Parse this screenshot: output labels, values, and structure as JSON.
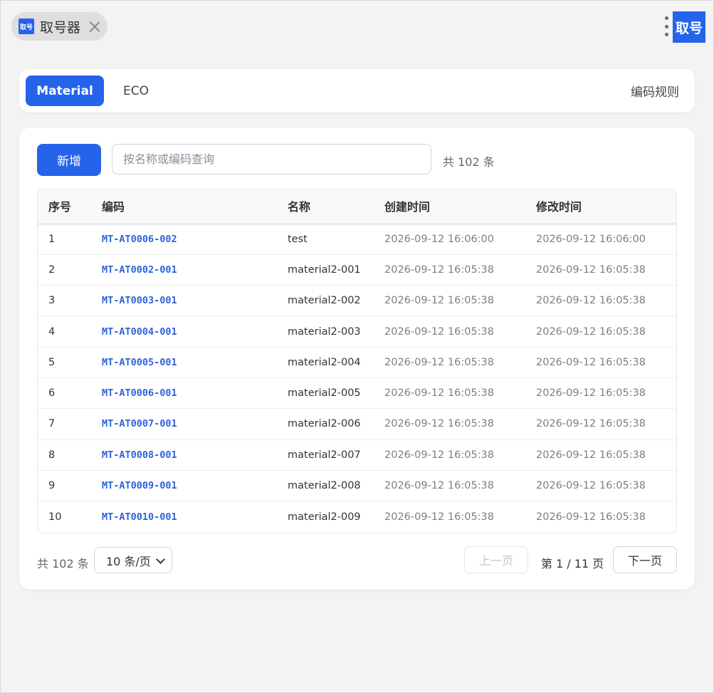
{
  "app_tab": {
    "icon_text": "取号",
    "title": "取号器"
  },
  "brand_badge": "取号",
  "tabs": [
    {
      "label": "Material",
      "active": true
    },
    {
      "label": "ECO",
      "active": false
    }
  ],
  "rules_tab": "编码规则",
  "toolbar": {
    "add_label": "新增",
    "search_placeholder": "按名称或编码查询",
    "search_value": "",
    "total_text": "共 102 条"
  },
  "table": {
    "columns": [
      "序号",
      "编码",
      "名称",
      "创建时间",
      "修改时间"
    ],
    "rows": [
      {
        "index": "1",
        "code": "MT-AT0006-002",
        "name": "test",
        "created": "2026-09-12 16:06:00",
        "modified": "2026-09-12 16:06:00"
      },
      {
        "index": "2",
        "code": "MT-AT0002-001",
        "name": "material2-001",
        "created": "2026-09-12 16:05:38",
        "modified": "2026-09-12 16:05:38"
      },
      {
        "index": "3",
        "code": "MT-AT0003-001",
        "name": "material2-002",
        "created": "2026-09-12 16:05:38",
        "modified": "2026-09-12 16:05:38"
      },
      {
        "index": "4",
        "code": "MT-AT0004-001",
        "name": "material2-003",
        "created": "2026-09-12 16:05:38",
        "modified": "2026-09-12 16:05:38"
      },
      {
        "index": "5",
        "code": "MT-AT0005-001",
        "name": "material2-004",
        "created": "2026-09-12 16:05:38",
        "modified": "2026-09-12 16:05:38"
      },
      {
        "index": "6",
        "code": "MT-AT0006-001",
        "name": "material2-005",
        "created": "2026-09-12 16:05:38",
        "modified": "2026-09-12 16:05:38"
      },
      {
        "index": "7",
        "code": "MT-AT0007-001",
        "name": "material2-006",
        "created": "2026-09-12 16:05:38",
        "modified": "2026-09-12 16:05:38"
      },
      {
        "index": "8",
        "code": "MT-AT0008-001",
        "name": "material2-007",
        "created": "2026-09-12 16:05:38",
        "modified": "2026-09-12 16:05:38"
      },
      {
        "index": "9",
        "code": "MT-AT0009-001",
        "name": "material2-008",
        "created": "2026-09-12 16:05:38",
        "modified": "2026-09-12 16:05:38"
      },
      {
        "index": "10",
        "code": "MT-AT0010-001",
        "name": "material2-009",
        "created": "2026-09-12 16:05:38",
        "modified": "2026-09-12 16:05:38"
      }
    ]
  },
  "pagination": {
    "total_text": "共 102 条",
    "page_size": "10 条/页",
    "prev_label": "上一页",
    "page_info": "第 1 / 11 页",
    "next_label": "下一页"
  },
  "colors": {
    "accent": "#2563eb",
    "code_link": "#2f63d8",
    "background": "#f3f3f3"
  },
  "icons": [
    "app-logo-icon",
    "close-icon",
    "more-vertical-icon",
    "chevron-down-icon"
  ]
}
